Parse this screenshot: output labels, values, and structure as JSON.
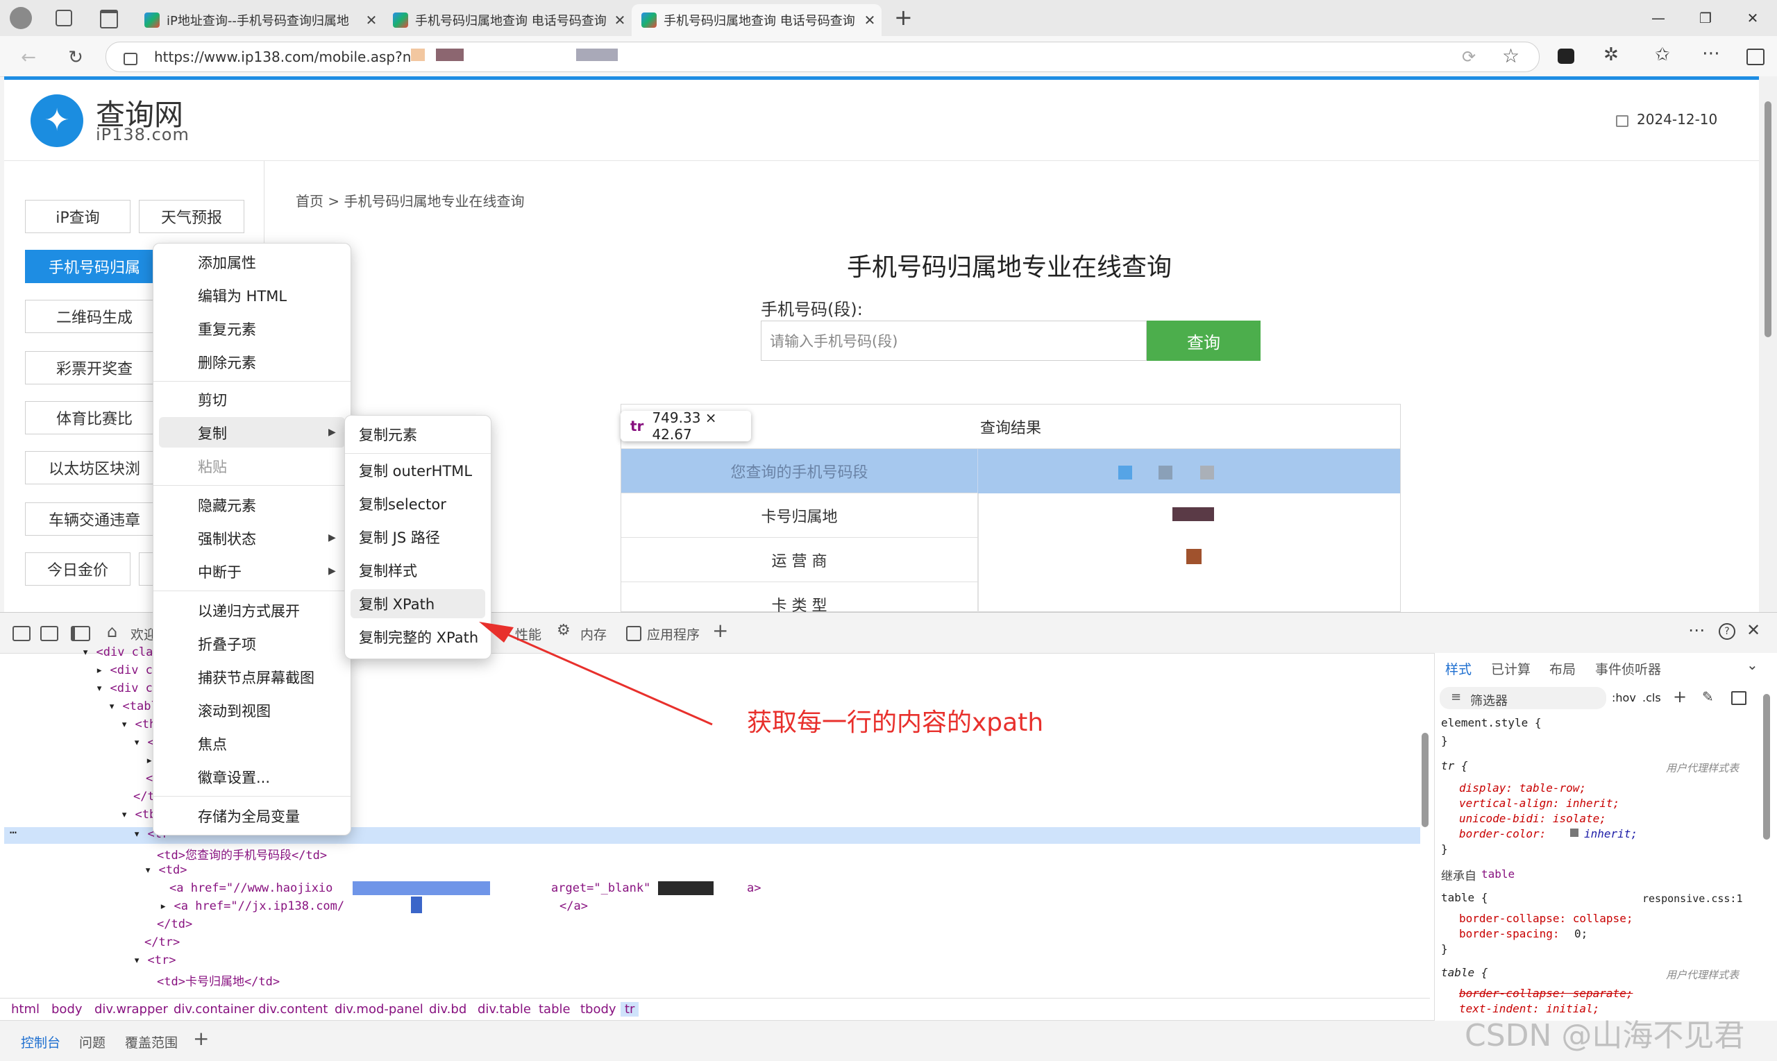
{
  "browser": {
    "tabs": [
      {
        "title": "iP地址查询--手机号码查询归属地",
        "active": false
      },
      {
        "title": "手机号码归属地查询 电话号码查询",
        "active": false
      },
      {
        "title": "手机号码归属地查询 电话号码查询",
        "active": true
      }
    ],
    "new_tab": "+",
    "url": "https://www.ip138.com/mobile.asp?n",
    "window_controls": {
      "minimize": "—",
      "restore": "❐",
      "close": "✕"
    }
  },
  "site": {
    "logo_cn": "查询网",
    "logo_en": "iP138.com",
    "date": "2024-12-10",
    "sidebar": [
      {
        "label": "iP查询"
      },
      {
        "label": "天气预报"
      },
      {
        "label": "手机号码归属"
      },
      {
        "label": "二维码生成"
      },
      {
        "label": "彩票开奖查"
      },
      {
        "label": "体育比赛比"
      },
      {
        "label": "以太坊区块浏"
      },
      {
        "label": "车辆交通违章"
      },
      {
        "label": "今日金价"
      }
    ],
    "breadcrumb": "首页 > 手机号码归属地专业在线查询",
    "title": "手机号码归属地专业在线查询",
    "input_label": "手机号码(段):",
    "input_placeholder": "请输入手机号码(段)",
    "query_button": "查询",
    "result_header": "查询结果",
    "result_rows": [
      {
        "label": "您查询的手机号码段"
      },
      {
        "label": "卡号归属地"
      },
      {
        "label": "运 营 商"
      },
      {
        "label": "卡 类 型"
      }
    ],
    "tooltip_tag": "tr",
    "tooltip_size": "749.33 × 42.67"
  },
  "context_menu": {
    "items": [
      "添加属性",
      "编辑为 HTML",
      "重复元素",
      "删除元素",
      "剪切",
      "复制",
      "粘贴",
      "隐藏元素",
      "强制状态",
      "中断于",
      "以递归方式展开",
      "折叠子项",
      "捕获节点屏幕截图",
      "滚动到视图",
      "焦点",
      "徽章设置...",
      "存储为全局变量"
    ],
    "submenu": [
      "复制元素",
      "复制 outerHTML",
      "复制selector",
      "复制 JS 路径",
      "复制样式",
      "复制 XPath",
      "复制完整的 XPath"
    ]
  },
  "annotation": "获取每一行的内容的xpath",
  "devtools": {
    "tabs": [
      "欢迎",
      "性能",
      "内存",
      "应用程序"
    ],
    "tab_add": "+",
    "dom_lines": [
      "<div clas",
      "<div cl",
      "<div cl",
      "<tabl",
      "<th",
      "<",
      "<",
      "</t",
      "</th",
      "<tb",
      "<tr",
      "<td>您查询的手机号码段</td>",
      "<td>",
      "<a href=\"//www.haojixio",
      "arget=\"_blank\"",
      "a>",
      "<a href=\"//jx.ip138.com/",
      "</a>",
      "</td>",
      "</tr>",
      "<tr>",
      "<td>卡号归属地</td>"
    ],
    "breadcrumbs": [
      "html",
      "body",
      "div.wrapper",
      "div.container",
      "div.content",
      "div.mod-panel",
      "div.bd",
      "div.table",
      "table",
      "tbody",
      "tr"
    ],
    "styles_tabs": [
      "样式",
      "已计算",
      "布局",
      "事件侦听器"
    ],
    "filter_placeholder": "筛选器",
    "hov": ":hov",
    "cls": ".cls",
    "styles": [
      "element.style {",
      "}",
      "tr {",
      "用户代理样式表",
      "display: table-row;",
      "vertical-align: inherit;",
      "unicode-bidi: isolate;",
      "border-color: ",
      "inherit;",
      "}",
      "继承自",
      "table",
      "table {",
      "responsive.css:1",
      "border-collapse: collapse;",
      "border-spacing: ",
      "0;",
      "}",
      "table {",
      "用户代理样式表",
      "border-collapse: separate;",
      "text-indent: initial;"
    ],
    "bottom_tabs": [
      "控制台",
      "问题",
      "覆盖范围"
    ],
    "bottom_add": "+"
  },
  "watermark": "CSDN @山海不见君"
}
